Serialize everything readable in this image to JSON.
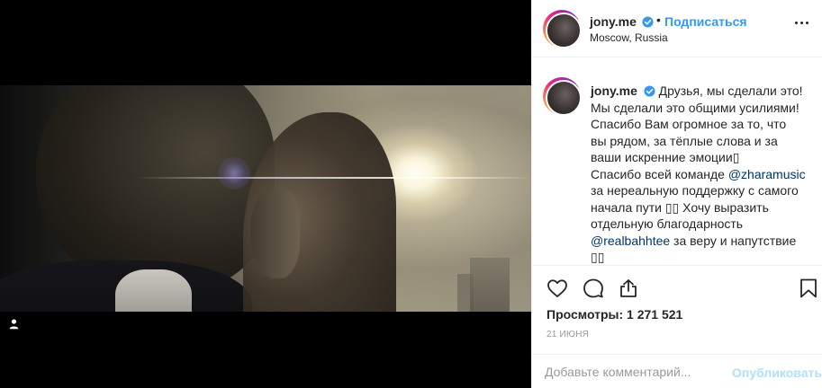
{
  "post": {
    "username": "jony.me",
    "verified": true,
    "separator": "•",
    "follow_label": "Подписаться",
    "location": "Moscow, Russia",
    "more_icon": "ellipsis-icon"
  },
  "media": {
    "type": "video",
    "tag_icon": "user-tag-icon"
  },
  "caption": {
    "username": "jony.me",
    "lines": [
      "Друзья, мы сделали это!",
      "Мы сделали это общими усилиями!",
      "Спасибо Вам огромное за то, что",
      "вы рядом, за тёплые слова и за",
      "ваши искренние эмоции"
    ],
    "thanks_prefix": "Спасибо всей команде ",
    "mention_1": "@zharamusic",
    "line_after_mention_1": "за нереальную поддержку с самого",
    "line_pre_2": "начала пути ",
    "line_pre_2b": " Хочу выразить",
    "line_pre_3": "отдельную благодарность",
    "mention_2": "@realbahhtee",
    "line_after_mention_2": " за веру и напутствие"
  },
  "actions": {
    "like_icon": "heart-icon",
    "comment_icon": "comment-icon",
    "share_icon": "share-icon",
    "save_icon": "bookmark-icon"
  },
  "stats": {
    "views": "Просмотры: 1 271 521",
    "date": "21 ИЮНЯ"
  },
  "comment_box": {
    "placeholder": "Добавьте комментарий...",
    "publish_label": "Опубликовать"
  },
  "colors": {
    "accent": "#3897f0",
    "verified": "#3897f0",
    "mention": "#003569",
    "publish_disabled": "#b2dffc"
  }
}
